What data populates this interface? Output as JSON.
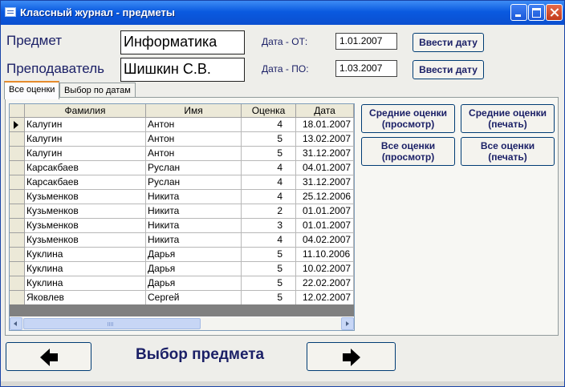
{
  "window": {
    "title": "Классный журнал - предметы"
  },
  "form": {
    "subject_label": "Предмет",
    "subject_value": "Информатика",
    "teacher_label": "Преподаватель",
    "teacher_value": "Шишкин С.В.",
    "date_from_label": "Дата - ОТ:",
    "date_from_value": "1.01.2007",
    "date_to_label": "Дата - ПО:",
    "date_to_value": "1.03.2007",
    "enter_date_button": "Ввести дату"
  },
  "tabs": [
    {
      "label": "Все оценки",
      "active": true
    },
    {
      "label": "Выбор по датам",
      "active": false
    }
  ],
  "grid": {
    "columns": [
      "Фамилия",
      "Имя",
      "Оценка",
      "Дата"
    ],
    "rows": [
      [
        "Калугин",
        "Антон",
        "4",
        "18.01.2007"
      ],
      [
        "Калугин",
        "Антон",
        "5",
        "13.02.2007"
      ],
      [
        "Калугин",
        "Антон",
        "5",
        "31.12.2007"
      ],
      [
        "Карсакбаев",
        "Руслан",
        "4",
        "04.01.2007"
      ],
      [
        "Карсакбаев",
        "Руслан",
        "4",
        "31.12.2007"
      ],
      [
        "Кузьменков",
        "Никита",
        "4",
        "25.12.2006"
      ],
      [
        "Кузьменков",
        "Никита",
        "2",
        "01.01.2007"
      ],
      [
        "Кузьменков",
        "Никита",
        "3",
        "01.01.2007"
      ],
      [
        "Кузьменков",
        "Никита",
        "4",
        "04.02.2007"
      ],
      [
        "Куклина",
        "Дарья",
        "5",
        "11.10.2006"
      ],
      [
        "Куклина",
        "Дарья",
        "5",
        "10.02.2007"
      ],
      [
        "Куклина",
        "Дарья",
        "5",
        "22.02.2007"
      ],
      [
        "Яковлев",
        "Сергей",
        "5",
        "12.02.2007"
      ]
    ]
  },
  "reports": {
    "avg_view": "Средние оценки (просмотр)",
    "avg_print": "Средние оценки (печать)",
    "all_view": "Все оценки (просмотр)",
    "all_print": "Все оценки (печать)"
  },
  "nav": {
    "title": "Выбор предмета"
  }
}
